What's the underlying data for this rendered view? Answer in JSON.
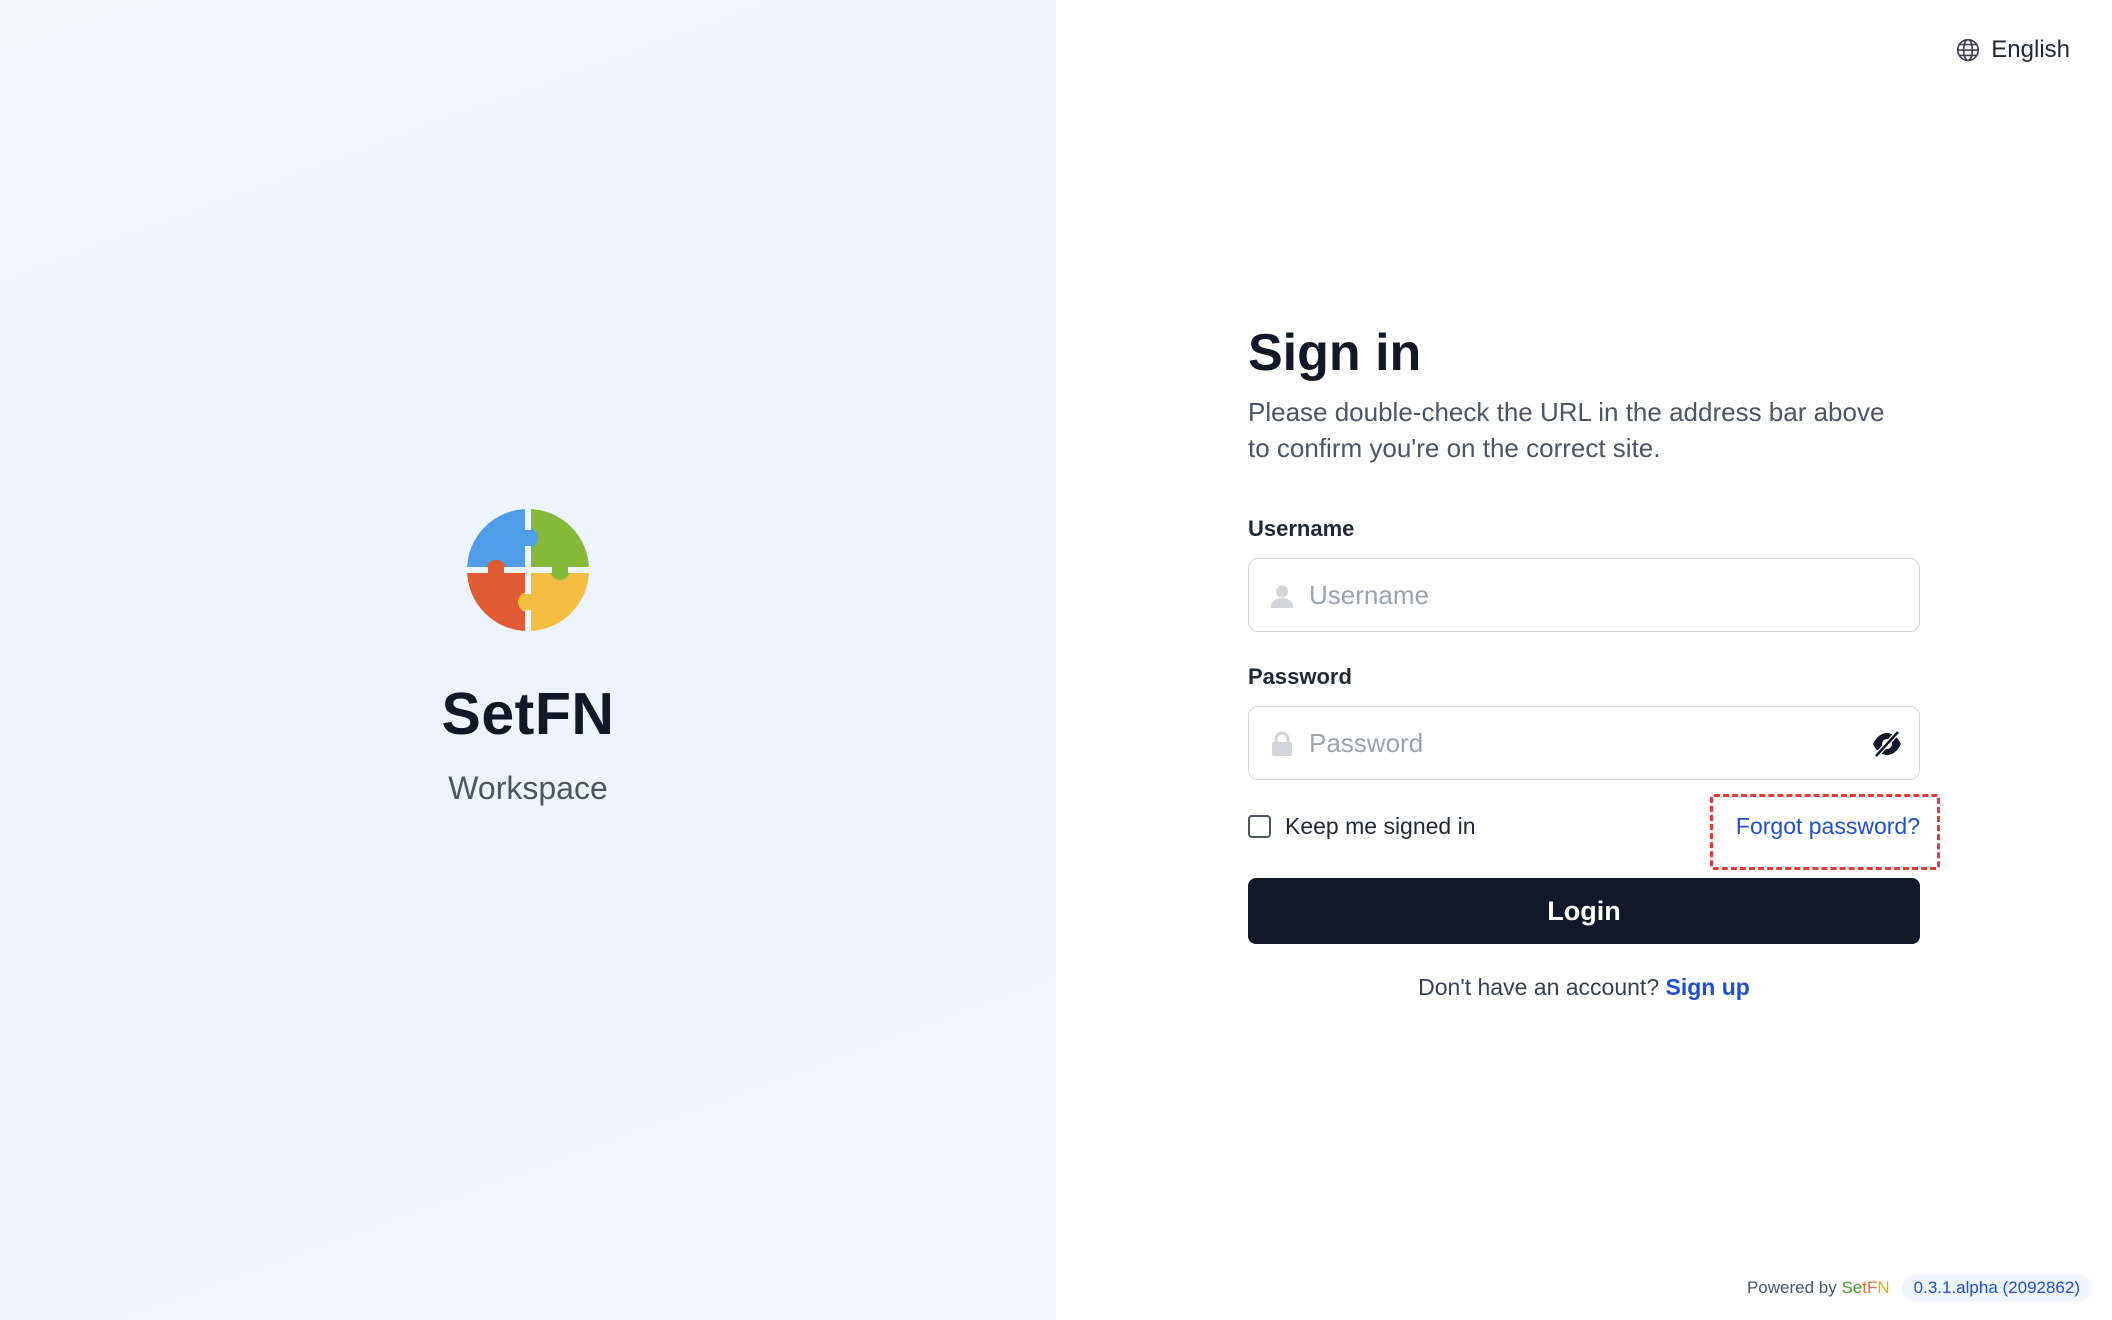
{
  "brand": {
    "name": "SetFN",
    "subtitle": "Workspace",
    "logo_icon": "puzzle-globe-icon",
    "colors": {
      "blue": "#4f9de8",
      "green": "#86b83a",
      "red": "#e25a33",
      "yellow": "#f3bd42"
    }
  },
  "header": {
    "language_label": "English",
    "language_icon": "globe-icon"
  },
  "form": {
    "title": "Sign in",
    "subtitle": "Please double-check the URL in the address bar above to confirm you're on the correct site.",
    "username_label": "Username",
    "username_placeholder": "Username",
    "username_value": "",
    "password_label": "Password",
    "password_placeholder": "Password",
    "password_value": "",
    "keep_signed_in_label": "Keep me signed in",
    "keep_signed_in_checked": false,
    "forgot_password_label": "Forgot password?",
    "login_label": "Login",
    "no_account_text": "Don't have an account?",
    "signup_label": "Sign up"
  },
  "footer": {
    "powered_by": "Powered by",
    "brand_part1": "Se",
    "brand_part2": "tF",
    "brand_part3": "N",
    "version": "0.3.1.alpha (2092862)"
  },
  "theme": {
    "primary_button": "#111827",
    "link": "#1d4ed8",
    "highlight_border": "#e53935"
  }
}
